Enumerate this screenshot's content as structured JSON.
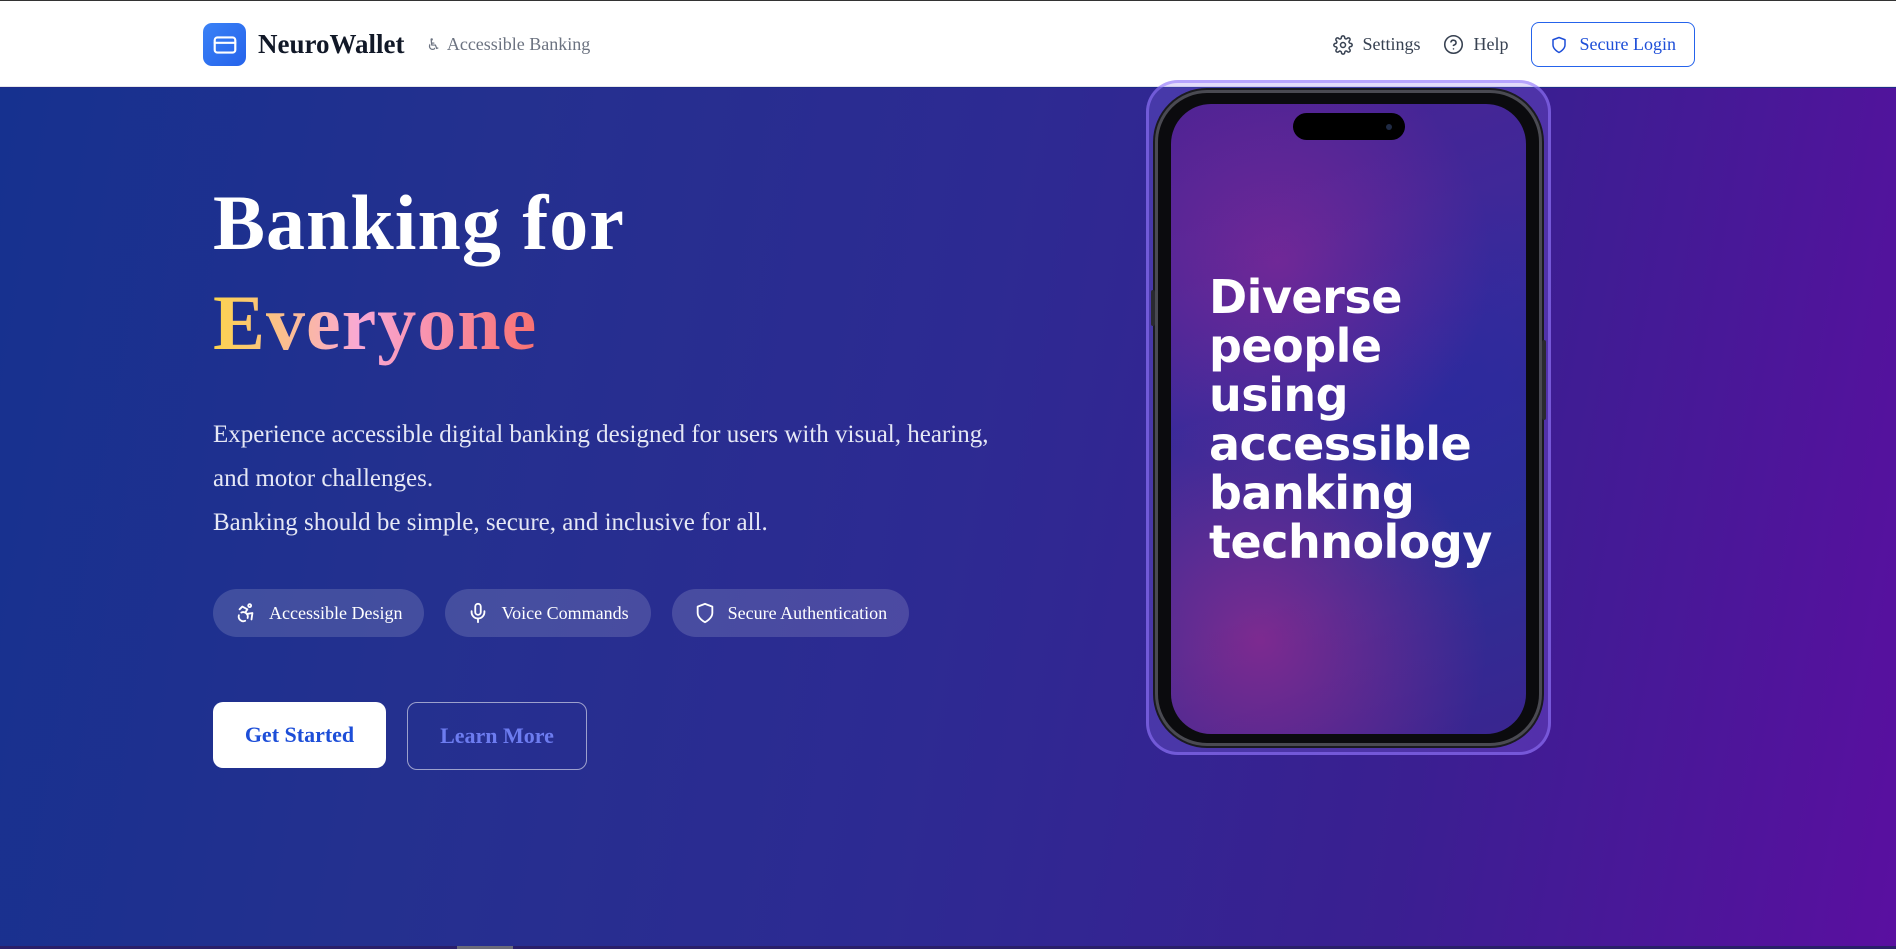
{
  "header": {
    "brand_name": "NeuroWallet",
    "brand_tagline": "Accessible Banking",
    "nav": {
      "settings": "Settings",
      "help": "Help",
      "login": "Secure Login"
    }
  },
  "hero": {
    "title_line1": "Banking for",
    "title_line2": "Everyone",
    "description_line1": "Experience accessible digital banking designed for users with visual, hearing, and motor challenges.",
    "description_line2": "Banking should be simple, secure, and inclusive for all.",
    "features": [
      {
        "label": "Accessible Design",
        "icon": "accessibility-icon"
      },
      {
        "label": "Voice Commands",
        "icon": "microphone-icon"
      },
      {
        "label": "Secure Authentication",
        "icon": "shield-icon"
      }
    ],
    "primary_cta": "Get Started",
    "secondary_cta": "Learn More"
  },
  "phone": {
    "screen_lines": [
      "Diverse",
      "people",
      "using",
      "accessible",
      "banking",
      "technology"
    ]
  },
  "colors": {
    "brand_blue": "#2563eb",
    "hero_start": "#16318f",
    "hero_end": "#5a0fa0",
    "accent_gradient": [
      "#fcd34d",
      "#f9a8d4",
      "#f87171"
    ]
  }
}
